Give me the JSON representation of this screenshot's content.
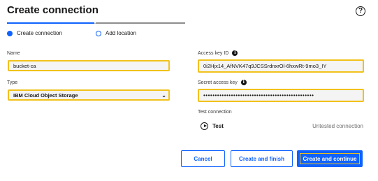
{
  "header": {
    "title": "Create connection",
    "help_icon": "help-icon"
  },
  "steps": [
    {
      "label": "Create connection",
      "state": "current"
    },
    {
      "label": "Add location",
      "state": "pending"
    }
  ],
  "form": {
    "name_label": "Name",
    "name_value": "bucket-ca",
    "type_label": "Type",
    "type_value": "IBM Cloud Object Storage",
    "access_key_label": "Access key ID",
    "access_key_value": "0i2Hjx14_AfNVK47q9JCSSrdnxrOl-6hxwRt-9mo3_IY",
    "secret_key_label": "Secret access key",
    "secret_key_value": "••••••••••••••••••••••••••••••••••••••••••••••••"
  },
  "test": {
    "label": "Test connection",
    "button_label": "Test",
    "status": "Untested connection"
  },
  "actions": {
    "cancel": "Cancel",
    "create_finish": "Create and finish",
    "create_continue": "Create and continue"
  },
  "colors": {
    "accent": "#0f62fe",
    "focus": "#f1c21b"
  }
}
